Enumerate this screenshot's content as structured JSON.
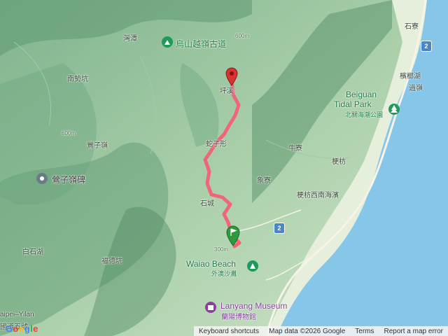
{
  "places": {
    "wanliu": "灣潭",
    "trail": "烏山越嶺古道",
    "nanshi": "南勢坑",
    "pingtop": "坪溪",
    "shezi": "蛇子形",
    "yingzi_ling": "鶯子嶺",
    "yingzi_monument": "鶯子嶺碑",
    "niuliao": "牛寮",
    "gengfang": "梗枋",
    "gengfang_beach": "梗枋西南海濱",
    "xiangliao": "象寮",
    "shicheng": "石城",
    "baishihu": "白石湖",
    "fudekeng": "福德坑",
    "waiao_en": "Waiao Beach",
    "waiao_zh": "外澳沙灘",
    "lanyang_en": "Lanyang Museum",
    "lanyang_zh": "蘭陽博物館",
    "beiguan_en1": "Beiguan",
    "beiguan_en2": "Tidal Park",
    "beiguan_zh": "北關海潮公園",
    "banqiao": "檳榔湖",
    "guoling": "過嶺",
    "jiliao": "石寮",
    "taipei_yilan": "aipei–Yilan",
    "taipei_yilan2": "國道五號",
    "elev_600_a": "600m",
    "elev_600_b": "600m",
    "elev_300": "300m"
  },
  "roads": {
    "r2_top": "2",
    "r2_mid": "2"
  },
  "footer": {
    "shortcuts": "Keyboard shortcuts",
    "mapdata": "Map data ©2026 Google",
    "terms": "Terms",
    "report": "Report a map error"
  },
  "colors": {
    "route": "#f0657a",
    "sea": "#86c6e8",
    "start_pin": "#2e9a3e",
    "end_pin": "#d8332e"
  }
}
